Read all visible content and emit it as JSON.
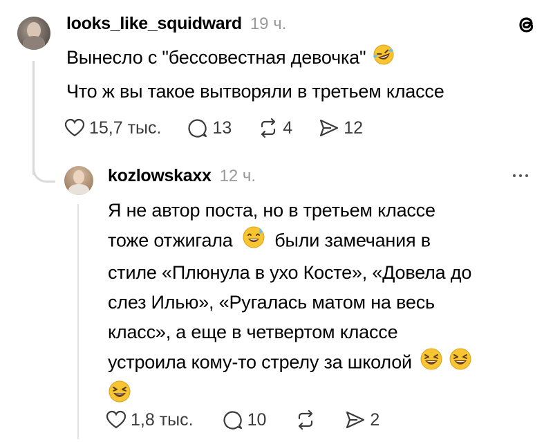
{
  "post": {
    "username": "looks_like_squidward",
    "time": "19 ч.",
    "line1": "Вынесло с \"бессовестная девочка\"",
    "line2": "Что ж вы такое вытворяли в третьем классе",
    "likes": "15,7 тыс.",
    "comments": "13",
    "reposts": "4",
    "shares": "12"
  },
  "reply": {
    "username": "kozlowskaxx",
    "time": "12 ч.",
    "lines": [
      "Я не автор поста, но в третьем классе",
      "тоже отжигала",
      "были замечания в",
      "стиле «Плюнула в ухо Косте», «Довела до",
      "слез Илью», «Ругалась матом на весь",
      "класс», а еще в четвертом классе",
      "устроила кому-то стрелу за школой"
    ],
    "likes": "1,8 тыс.",
    "comments": "10",
    "shares": "2"
  },
  "icons": {
    "app": "threads-logo-icon",
    "more": "more-options-icon",
    "like": "heart-icon",
    "comment": "comment-icon",
    "repost": "repost-icon",
    "share": "share-icon"
  }
}
